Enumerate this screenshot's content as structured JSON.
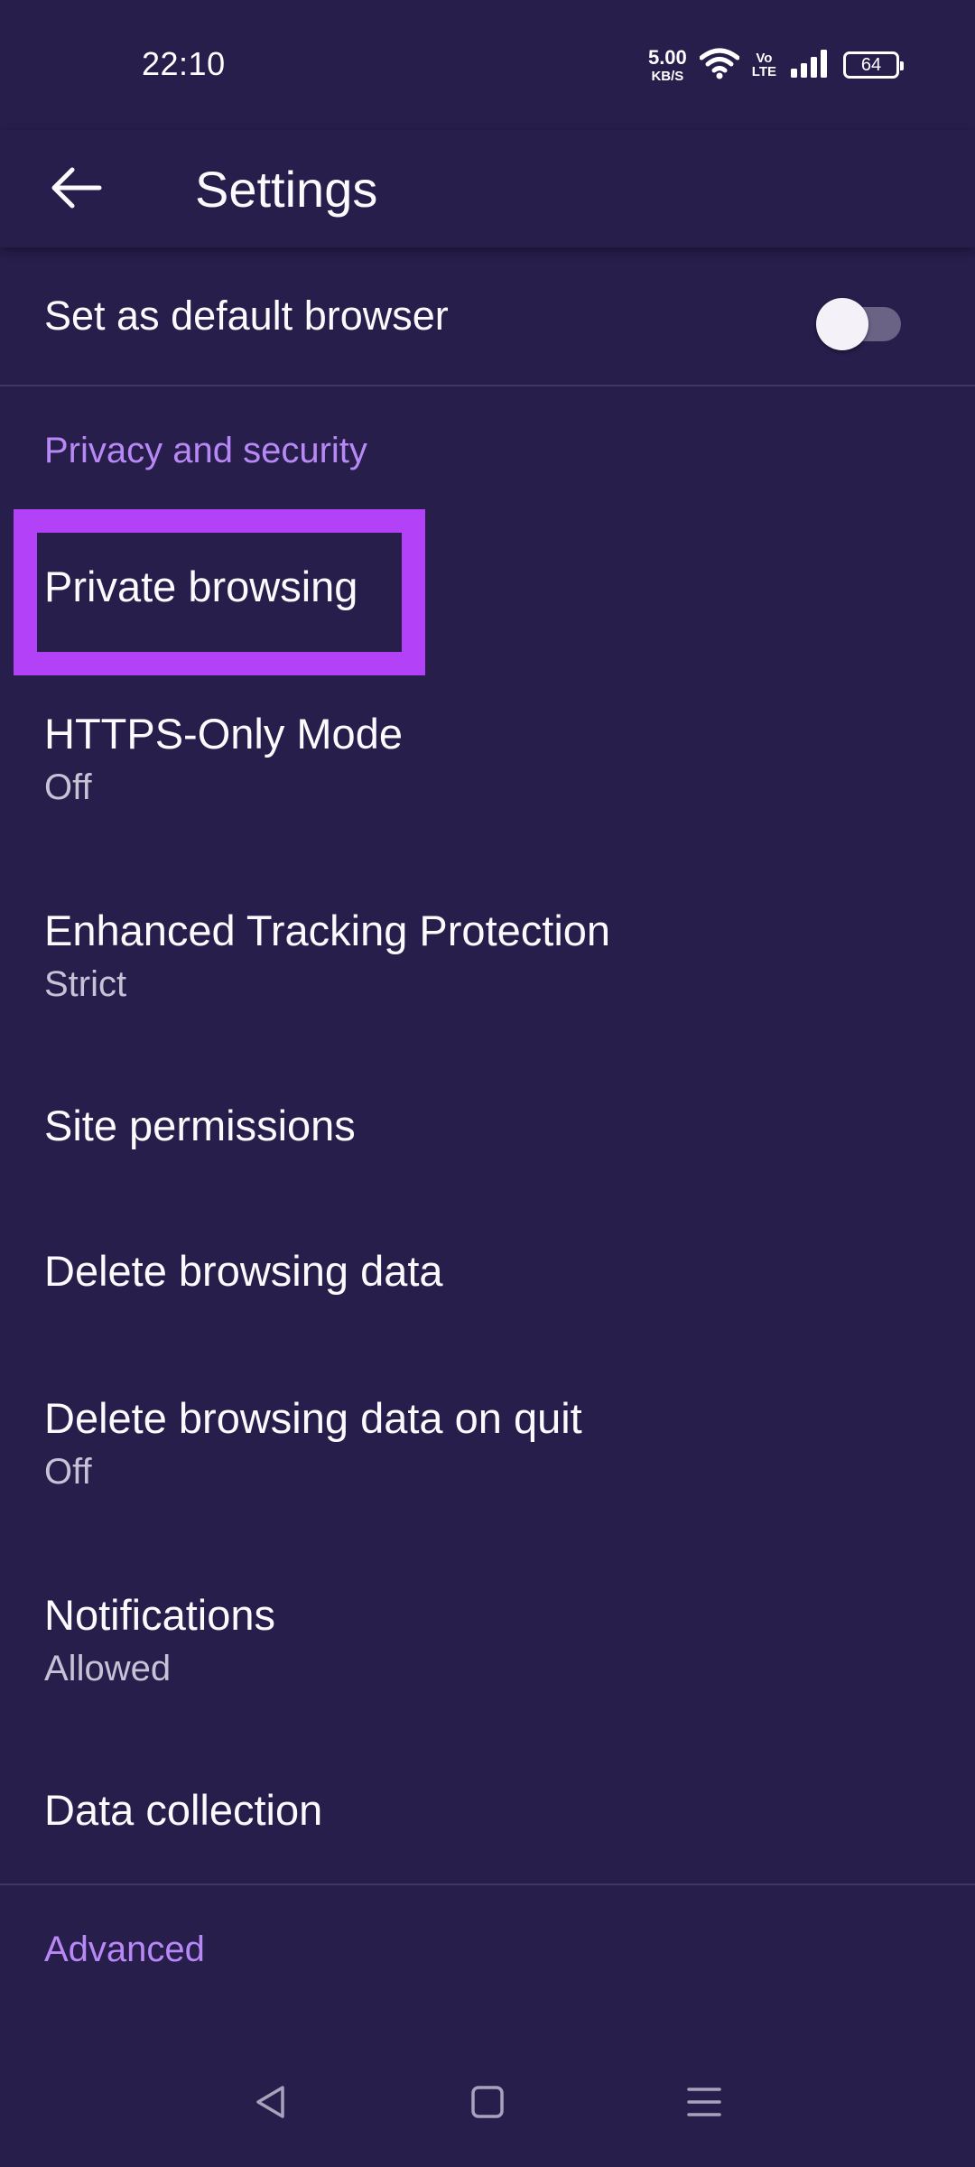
{
  "status_bar": {
    "time": "22:10",
    "net_speed_value": "5.00",
    "net_speed_unit": "KB/S",
    "volte_top": "Vo",
    "volte_bottom": "LTE",
    "battery": "64",
    "icons": [
      "wifi-icon",
      "signal-icon",
      "battery-icon"
    ]
  },
  "app_bar": {
    "back_icon": "arrow-left-icon",
    "title": "Settings"
  },
  "default_browser": {
    "label": "Set as default browser",
    "toggle_on": false
  },
  "privacy_section": {
    "header": "Privacy and security",
    "items": [
      {
        "title": "Private browsing",
        "summary": ""
      },
      {
        "title": "HTTPS-Only Mode",
        "summary": "Off"
      },
      {
        "title": "Enhanced Tracking Protection",
        "summary": "Strict"
      },
      {
        "title": "Site permissions",
        "summary": ""
      },
      {
        "title": "Delete browsing data",
        "summary": ""
      },
      {
        "title": "Delete browsing data on quit",
        "summary": "Off"
      },
      {
        "title": "Notifications",
        "summary": "Allowed"
      },
      {
        "title": "Data collection",
        "summary": ""
      }
    ]
  },
  "advanced_section": {
    "header": "Advanced"
  },
  "nav_bar": {
    "icons": [
      "back-triangle-icon",
      "home-square-icon",
      "menu-lines-icon"
    ]
  },
  "colors": {
    "background": "#271e4c",
    "accent": "#b889f6",
    "highlight": "#b341f8",
    "text_primary": "#fbfbfe",
    "text_secondary": "#c7c3d6"
  }
}
